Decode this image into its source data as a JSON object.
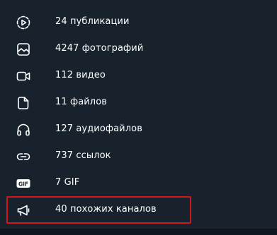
{
  "menu": {
    "items": [
      {
        "icon": "play-circle-icon",
        "label": "24 публикации"
      },
      {
        "icon": "photo-icon",
        "label": "4247 фотографий"
      },
      {
        "icon": "video-icon",
        "label": "112 видео"
      },
      {
        "icon": "file-icon",
        "label": "11 файлов"
      },
      {
        "icon": "headphones-icon",
        "label": "127 аудиофайлов"
      },
      {
        "icon": "link-icon",
        "label": "737 ссылок"
      },
      {
        "icon": "gif-icon",
        "label": "7 GIF"
      },
      {
        "icon": "megaphone-icon",
        "label": "40 похожих каналов"
      }
    ],
    "highlighted_item": "40 похожих каналов"
  },
  "colors": {
    "background": "#18222d",
    "text": "#ffffff",
    "icon": "#ffffff",
    "highlight_border": "#d0181b"
  }
}
